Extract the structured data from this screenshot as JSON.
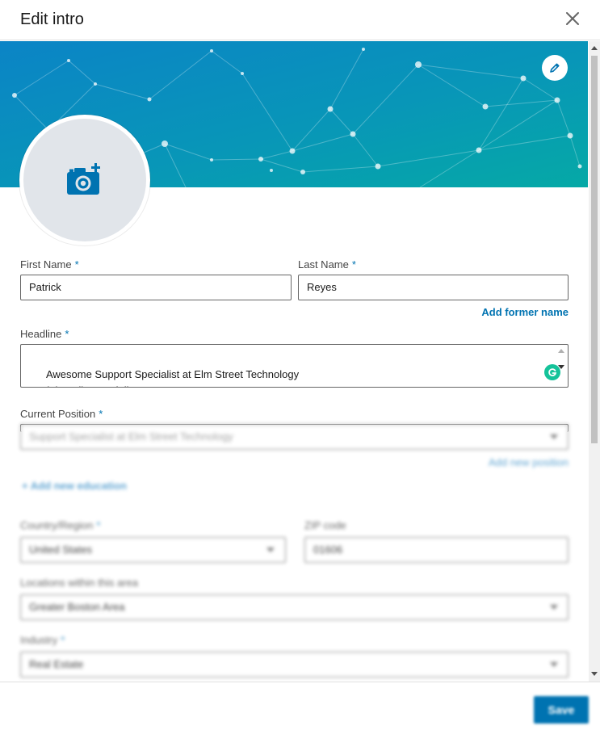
{
  "header": {
    "title": "Edit intro"
  },
  "form": {
    "first_name": {
      "label": "First Name",
      "required": "*",
      "value": "Patrick"
    },
    "last_name": {
      "label": "Last Name",
      "required": "*",
      "value": "Reyes"
    },
    "add_former_name": "Add former name",
    "headline": {
      "label": "Headline",
      "required": "*",
      "value": "Awesome Support Specialist at Elm Street Technology\nSocial Media Specialist\nWeb Developer"
    },
    "current_position": {
      "label": "Current Position",
      "required": "*",
      "value": "Support Specialist at Elm Street Technology"
    },
    "add_new_position": "Add new position",
    "add_new_education": "Add new education",
    "country": {
      "label": "Country/Region",
      "required": "*",
      "value": "United States"
    },
    "zip": {
      "label": "ZIP code",
      "value": "01606"
    },
    "locations": {
      "label": "Locations within this area",
      "value": "Greater Boston Area"
    },
    "industry": {
      "label": "Industry",
      "required": "*",
      "value": "Real Estate"
    }
  },
  "footer": {
    "save_label": "Save"
  },
  "colors": {
    "accent": "#0073b1",
    "banner_start": "#0a7bc4",
    "banner_end": "#06a6a8",
    "grammarly": "#15c39a"
  }
}
